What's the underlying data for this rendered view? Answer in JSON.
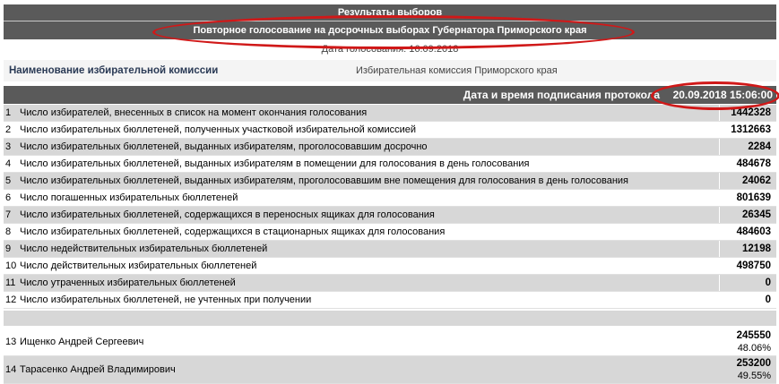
{
  "header": {
    "title": "Результаты выборов",
    "election": "Повторное голосование на досрочных выборах Губернатора Приморского края",
    "date_line": "Дата голосования:  16.09.2018"
  },
  "commission": {
    "label": "Наименование избирательной комиссии",
    "value": "Избирательная комиссия Приморского края"
  },
  "protocol": {
    "label": "Дата и время подписания протокола",
    "value": "20.09.2018 15:06:00"
  },
  "rows": [
    {
      "num": "1",
      "text": "Число избирателей, внесенных в список на момент окончания голосования",
      "value": "1442328"
    },
    {
      "num": "2",
      "text": "Число избирательных бюллетеней, полученных участковой избирательной комиссией",
      "value": "1312663"
    },
    {
      "num": "3",
      "text": "Число избирательных бюллетеней, выданных избирателям, проголосовавшим досрочно",
      "value": "2284"
    },
    {
      "num": "4",
      "text": "Число избирательных бюллетеней, выданных избирателям в помещении для голосования в день голосования",
      "value": "484678"
    },
    {
      "num": "5",
      "text": "Число избирательных бюллетеней, выданных избирателям, проголосовавшим вне помещения для голосования в день голосования",
      "value": "24062"
    },
    {
      "num": "6",
      "text": "Число погашенных избирательных бюллетеней",
      "value": "801639"
    },
    {
      "num": "7",
      "text": "Число избирательных бюллетеней, содержащихся в переносных ящиках для голосования",
      "value": "26345"
    },
    {
      "num": "8",
      "text": "Число избирательных бюллетеней, содержащихся в стационарных ящиках для голосования",
      "value": "484603"
    },
    {
      "num": "9",
      "text": "Число недействительных избирательных бюллетеней",
      "value": "12198"
    },
    {
      "num": "10",
      "text": "Число действительных избирательных бюллетеней",
      "value": "498750"
    },
    {
      "num": "11",
      "text": "Число утраченных избирательных бюллетеней",
      "value": "0"
    },
    {
      "num": "12",
      "text": "Число избирательных бюллетеней, не учтенных при получении",
      "value": "0"
    }
  ],
  "candidates": [
    {
      "num": "13",
      "name": "Ищенко Андрей Сергеевич",
      "votes": "245550",
      "percent": "48.06%"
    },
    {
      "num": "14",
      "name": "Тарасенко Андрей Владимирович",
      "votes": "253200",
      "percent": "49.55%"
    }
  ],
  "colors": {
    "header_bg": "#5a5a5a",
    "row_alt_bg": "#d7d7d7",
    "highlight_oval": "#d01818"
  }
}
